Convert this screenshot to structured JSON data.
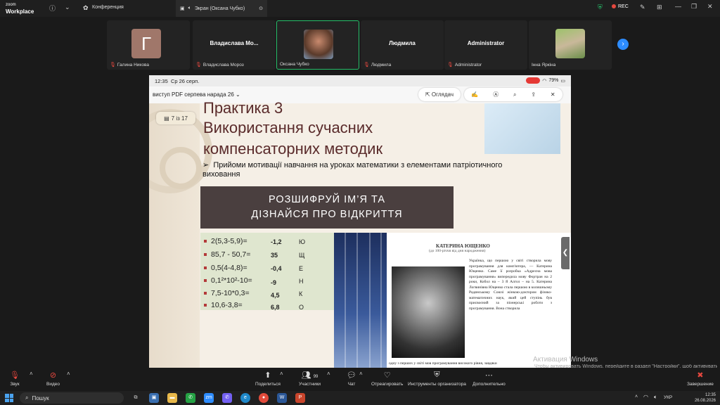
{
  "app": {
    "brand_top": "zoom",
    "brand_bottom": "Workplace"
  },
  "topbar": {
    "conference_label": "Конференция",
    "share_tab": "Экран (Оксана Чубко)",
    "rec_label": "REC"
  },
  "participants": [
    {
      "initial": "Г",
      "name": "Галина Никова"
    },
    {
      "center": "Владислава  Мо...",
      "name": "Владислава Мороз"
    },
    {
      "name": "Оксана Чубко"
    },
    {
      "center": "Людмила",
      "name": "Людмила"
    },
    {
      "center": "Administrator",
      "name": "Administrator"
    },
    {
      "name": "Інна Яркіна"
    }
  ],
  "ipad": {
    "time": "12:35",
    "date": "Ср 26 серп.",
    "battery": "79%",
    "doc_title": "виступ  PDF серпева нарада 26",
    "view_label": "Оглядач",
    "page_indicator": "7 із 17"
  },
  "slide": {
    "title1": "Практика 3",
    "title2": "Використання сучасних компенсаторних методик",
    "bullet_marker": "➢",
    "bullet": "Прийоми мотивації  навчання на уроках математики з елементами патріотичного виховання",
    "banner_line1": "РОЗШИФРУЙ ІМ’Я ТА",
    "banner_line2": "ДІЗНАЙСЯ ПРО ВІДКРИТТЯ",
    "tasks": [
      {
        "expr": "2(5,3-5,9)=",
        "ans": "-1,2",
        "letter": "Ю"
      },
      {
        "expr": "85,7 - 50,7=",
        "ans": "35",
        "letter": "Щ"
      },
      {
        "expr": "0,5(4-4,8)=",
        "ans": "-0,4",
        "letter": "Е"
      },
      {
        "expr": "0,1²*10²-10=",
        "ans": "-9",
        "letter": "Н"
      },
      {
        "expr": "7,5-10*0,3=",
        "ans": "4,5",
        "letter": "К"
      },
      {
        "expr": "10,6-3,8=",
        "ans": "6,8",
        "letter": "О"
      }
    ],
    "article": {
      "title": "КАТЕРИНА ЮЩЕНКО",
      "subtitle": "(до 100-річчя від дня народження)",
      "text": "Українка, що першою у світі створила мову програмування для комп'ютера, — Катерина Ющенко. Саме її розробка «Адресна мова програмування» випередила мову Фортран на 2 роки, Кобол на – 3 й Алгол – на 5. Катерина Логвинівна Ющенко стала першою в колишньому Радянському Союзі жінкою-доктором фізико-математичних наук, який цей ступінь був присвоєний за піонерські роботи з програмування. Вона створила",
      "bottom": "одну з перших у світі мов програмування високого рівня, завдяки"
    }
  },
  "watermark": {
    "line1": "Активация Windows",
    "line2": "Чтобы активировать Windows, перейдите в раздел \"Настройки\", щоб активувати Windows."
  },
  "controls": {
    "audio": "Звук",
    "video": "Видео",
    "share": "Поделиться",
    "participants": "Участники",
    "participants_count": "99",
    "chat": "Чат",
    "react": "Отреагировать",
    "host_tools": "Инструменты организатора",
    "more": "Дополнительно",
    "end": "Завершение"
  },
  "taskbar": {
    "search_placeholder": "Пошук",
    "lang": "УКР",
    "time": "12:35",
    "date": "26.08.2026"
  },
  "colors": {
    "accent": "#2d8cff",
    "rec": "#e5483f",
    "active_border": "#26c06a",
    "slide_title": "#5a2b2b"
  }
}
